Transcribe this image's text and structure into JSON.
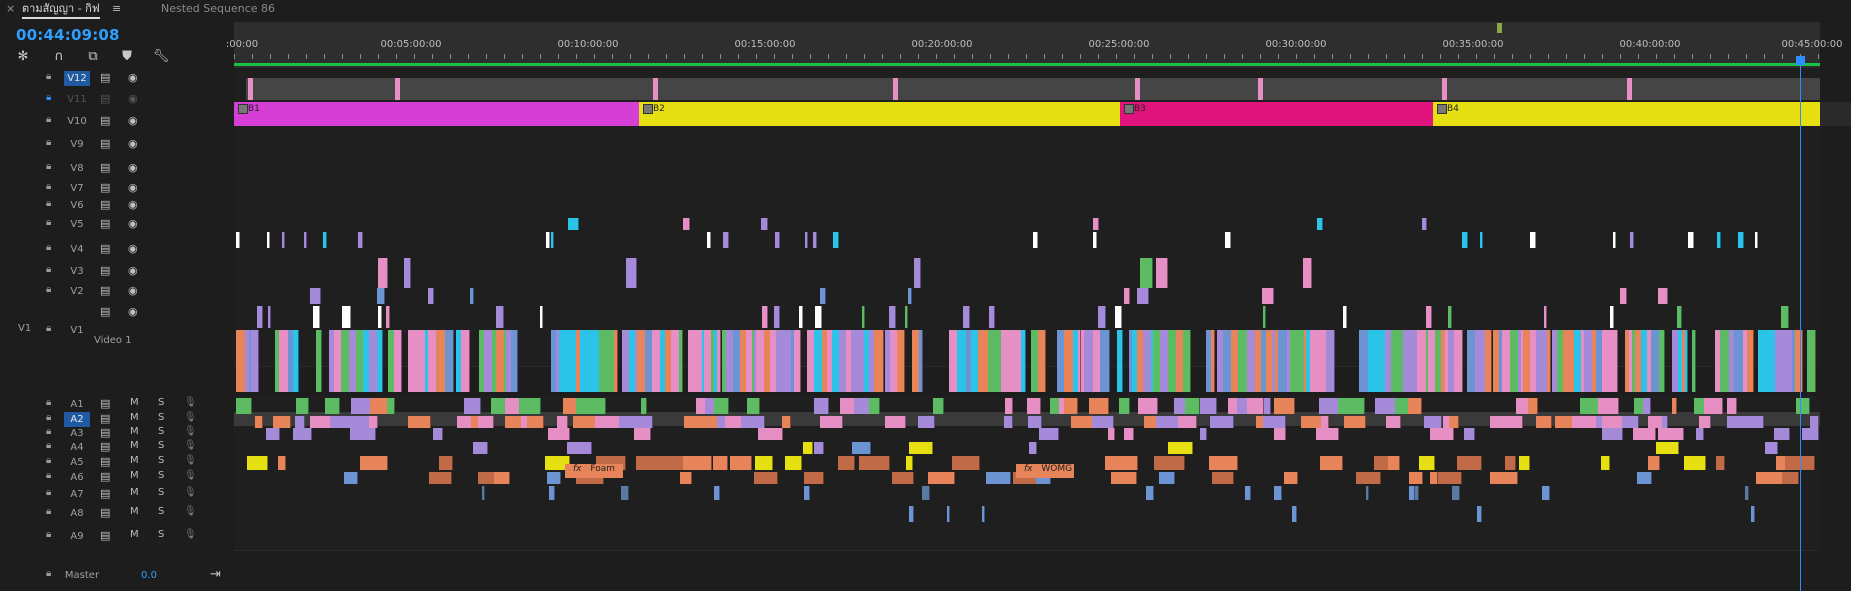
{
  "tabs": [
    {
      "label": "ตามสัญญา - กิฟ",
      "active": true
    },
    {
      "label": "Nested Sequence 86",
      "active": false
    }
  ],
  "tab_close_glyph": "×",
  "tab_menu_glyph": "≡",
  "timecode": "00:44:09:08",
  "toolbar": [
    {
      "icon": "snap-icon"
    },
    {
      "icon": "magnet-icon"
    },
    {
      "icon": "linked-selection-icon"
    },
    {
      "icon": "add-marker-icon"
    },
    {
      "icon": "wrench-icon"
    }
  ],
  "ruler": {
    "labels": [
      ":00:00",
      "00:05:00:00",
      "00:10:00:00",
      "00:15:00:00",
      "00:20:00:00",
      "00:25:00:00",
      "00:30:00:00",
      "00:35:00:00",
      "00:40:00:00",
      "00:45:00:00"
    ],
    "work_area_color": "#19c34a"
  },
  "video_tracks": [
    {
      "name": "V12",
      "selected": true,
      "locked": true
    },
    {
      "name": "V11",
      "selected": false,
      "locked": true,
      "disabled": true
    },
    {
      "name": "V10",
      "selected": false,
      "locked": false
    },
    {
      "name": "V9",
      "selected": false,
      "locked": false
    },
    {
      "name": "V8",
      "selected": false,
      "locked": false
    },
    {
      "name": "V7",
      "selected": false,
      "locked": false
    },
    {
      "name": "V6",
      "selected": false,
      "locked": false
    },
    {
      "name": "V5",
      "selected": false,
      "locked": false
    },
    {
      "name": "V4",
      "selected": false,
      "locked": false
    },
    {
      "name": "V3",
      "selected": false,
      "locked": false
    },
    {
      "name": "V2",
      "selected": false,
      "locked": false
    },
    {
      "name": "V1",
      "selected": false,
      "locked": false,
      "source": "V1",
      "label": "Video 1"
    }
  ],
  "audio_tracks": [
    {
      "name": "A1",
      "selected": false
    },
    {
      "name": "A2",
      "selected": true
    },
    {
      "name": "A3",
      "selected": false
    },
    {
      "name": "A4",
      "selected": false
    },
    {
      "name": "A5",
      "selected": false
    },
    {
      "name": "A6",
      "selected": false
    },
    {
      "name": "A7",
      "selected": false
    },
    {
      "name": "A8",
      "selected": false
    },
    {
      "name": "A9",
      "selected": false
    }
  ],
  "track_buttons": {
    "mute": "M",
    "solo": "S"
  },
  "master": {
    "label": "Master",
    "value": "0.0"
  },
  "nested_sequences": [
    {
      "label": "B1",
      "color": "#d63fd6"
    },
    {
      "label": "B2",
      "color": "#e6e012"
    },
    {
      "label": "B3",
      "color": "#e0147c"
    },
    {
      "label": "B4",
      "color": "#e6e012"
    }
  ],
  "effect_clips": [
    {
      "label": "Foam"
    },
    {
      "label": "WOMG"
    }
  ],
  "fx_badge": "fx",
  "colors": {
    "playhead": "#2f8cff",
    "timecode": "#2f9fff",
    "selected_track": "#1f5aa3",
    "clip_green": "#5dbb63",
    "clip_purple": "#a48ad8",
    "clip_blue": "#6d94d2",
    "clip_cyan": "#2bc4e8",
    "clip_pink": "#e58fc4",
    "clip_orange": "#e8845a",
    "clip_yellow": "#e6e012"
  }
}
